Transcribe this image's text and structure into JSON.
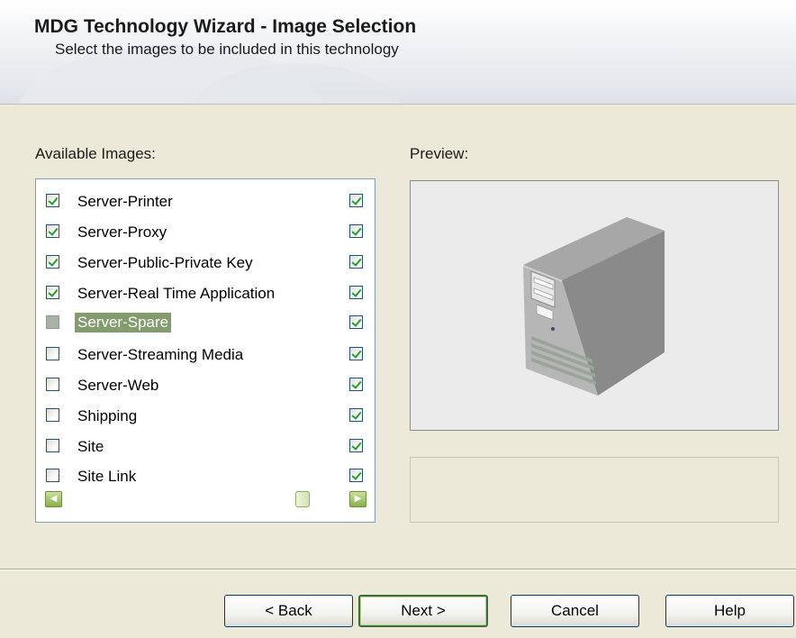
{
  "header": {
    "title": "MDG Technology Wizard - Image Selection",
    "subtitle": "Select the images to be included in this technology"
  },
  "available_images": {
    "label": "Available Images:",
    "items": [
      {
        "label": "Server-Printer",
        "checked": true,
        "second_checked": true
      },
      {
        "label": "Server-Proxy",
        "checked": true,
        "second_checked": true
      },
      {
        "label": "Server-Public-Private Key",
        "checked": true,
        "second_checked": true
      },
      {
        "label": "Server-Real Time Application",
        "checked": true,
        "second_checked": true
      },
      {
        "label": "Server-Spare",
        "checked": false,
        "second_checked": true,
        "selected": true
      },
      {
        "label": "Server-Streaming Media",
        "checked": false,
        "second_checked": true
      },
      {
        "label": "Server-Web",
        "checked": false,
        "second_checked": true
      },
      {
        "label": "Shipping",
        "checked": false,
        "second_checked": true
      },
      {
        "label": "Site",
        "checked": false,
        "second_checked": true
      },
      {
        "label": "Site Link",
        "checked": false,
        "second_checked": true
      }
    ]
  },
  "preview": {
    "label": "Preview:",
    "image": "server-icon",
    "description": ""
  },
  "buttons": {
    "back": "< Back",
    "next": "Next >",
    "cancel": "Cancel",
    "help": "Help"
  },
  "colors": {
    "selection": "#839c6d",
    "check": "#21a121",
    "dialog_bg": "#ece9d8"
  }
}
